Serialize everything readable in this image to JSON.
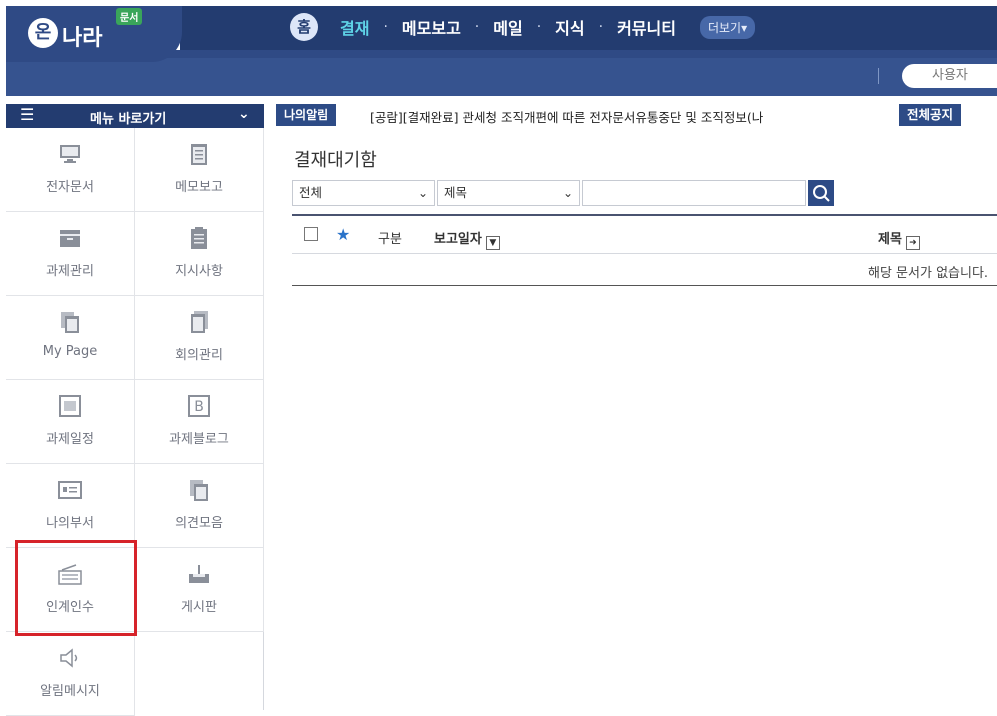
{
  "logo": {
    "mark": "온",
    "name": "나라",
    "badge": "문서"
  },
  "nav": {
    "home": "홈",
    "items": [
      "결재",
      "메모보고",
      "메일",
      "지식",
      "커뮤니티"
    ],
    "more": "더보기▾"
  },
  "user_search": {
    "placeholder": "사용자"
  },
  "sidebar": {
    "menu_title": "메뉴 바로가기",
    "items": [
      {
        "label": "전자문서",
        "icon": "monitor-icon"
      },
      {
        "label": "메모보고",
        "icon": "notepad-icon"
      },
      {
        "label": "과제관리",
        "icon": "cabinet-icon"
      },
      {
        "label": "지시사항",
        "icon": "clipboard-icon"
      },
      {
        "label": "My Page",
        "icon": "pages-icon"
      },
      {
        "label": "회의관리",
        "icon": "document-icon"
      },
      {
        "label": "과제일정",
        "icon": "calendar-icon"
      },
      {
        "label": "과제블로그",
        "icon": "blog-icon"
      },
      {
        "label": "나의부서",
        "icon": "id-card-icon"
      },
      {
        "label": "의견모음",
        "icon": "stack-icon"
      },
      {
        "label": "인계인수",
        "icon": "keyboard-icon"
      },
      {
        "label": "게시판",
        "icon": "tray-icon"
      },
      {
        "label": "알림메시지",
        "icon": "speaker-icon"
      }
    ]
  },
  "notice": {
    "tag": "나의알림",
    "text": "[공람][결재완료] 관세청 조직개편에 따른 전자문서유통중단 및 조직정보(나",
    "all_label": "전체공지"
  },
  "main": {
    "title": "결재대기함",
    "filter_scope": "전체",
    "filter_field": "제목",
    "columns": {
      "type": "구분",
      "date": "보고일자",
      "subject": "제목"
    },
    "empty_message": "해당 문서가 없습니다."
  },
  "colors": {
    "nav_bg": "#233c70",
    "accent": "#5fd3e7",
    "highlight": "#d6232a"
  }
}
